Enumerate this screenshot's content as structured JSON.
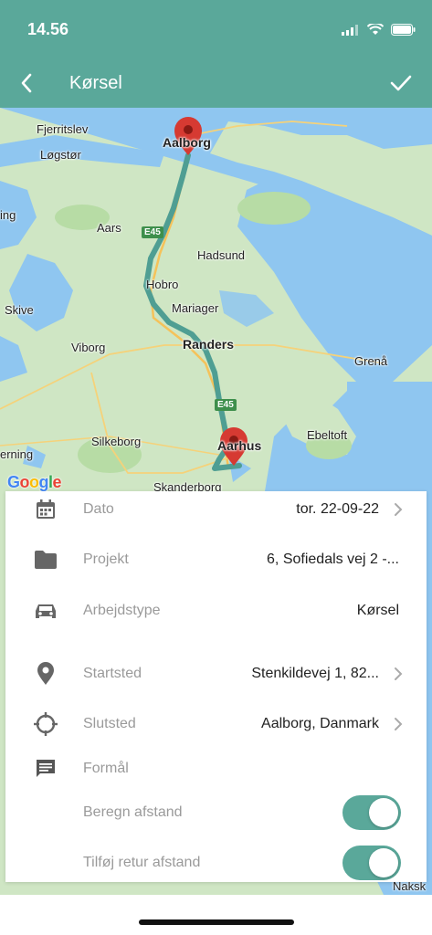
{
  "status_bar": {
    "time": "14.56"
  },
  "header": {
    "title": "Kørsel",
    "back_icon": "chevron-left-icon",
    "confirm_icon": "checkmark-icon"
  },
  "map": {
    "provider": "Google",
    "labels": {
      "fjerritslev": "Fjerritslev",
      "aalborg": "Aalborg",
      "logstor": "Løgstør",
      "ing": "ing",
      "aars": "Aars",
      "hadsund": "Hadsund",
      "hobro": "Hobro",
      "mariager": "Mariager",
      "skive": "Skive",
      "randers": "Randers",
      "viborg": "Viborg",
      "grena": "Grenå",
      "ebeltoft": "Ebeltoft",
      "silkeborg": "Silkeborg",
      "erning": "erning",
      "aarhus": "Aarhus",
      "skanderborg": "Skanderborg",
      "naksk": "Naksk"
    },
    "road_badges": {
      "upper": "E45",
      "lower": "E45"
    }
  },
  "form": {
    "date": {
      "label": "Dato",
      "value": "tor. 22-09-22",
      "icon": "calendar-icon"
    },
    "project": {
      "label": "Projekt",
      "value": "6, Sofiedals vej 2 -...",
      "icon": "folder-icon"
    },
    "work_type": {
      "label": "Arbejdstype",
      "value": "Kørsel",
      "icon": "car-icon"
    },
    "start": {
      "label": "Startsted",
      "value": "Stenkildevej 1, 82...",
      "icon": "location-pin-icon"
    },
    "end": {
      "label": "Slutsted",
      "value": "Aalborg, Danmark",
      "icon": "crosshair-icon"
    },
    "purpose": {
      "label": "Formål",
      "icon": "message-icon"
    },
    "calc_distance": {
      "label": "Beregn afstand",
      "on": true
    },
    "add_return": {
      "label": "Tilføj retur afstand",
      "on": true
    }
  },
  "colors": {
    "accent": "#5aa89a",
    "map_land": "#cfe6c4",
    "map_water": "#8fc6f0",
    "route": "#4f9e93",
    "marker": "#d63a32"
  }
}
